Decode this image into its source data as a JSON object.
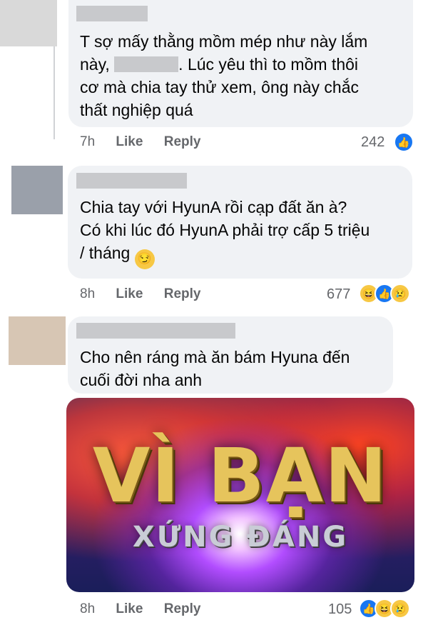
{
  "comments": [
    {
      "text_before": "T sợ mấy thằng mồm mép như này lắm\nnày,",
      "text_after": ". Lúc yêu thì to mồm thôi\ncơ mà chia tay thử xem, ông này chắc\nthất nghiệp quá",
      "time": "7h",
      "like_label": "Like",
      "reply_label": "Reply",
      "reaction_count": "242",
      "reactions": [
        "like"
      ]
    },
    {
      "text": "Chia tay với HyunA rồi cạp đất ăn à?\nCó khi lúc đó HyunA phải trợ cấp 5 triệu\n/ tháng",
      "emoji": "smirk",
      "time": "8h",
      "like_label": "Like",
      "reply_label": "Reply",
      "reaction_count": "677",
      "reactions": [
        "haha",
        "like",
        "sad"
      ]
    },
    {
      "text": "Cho nên ráng mà ăn bám Hyuna đến\ncuối đời nha anh",
      "meme": {
        "title": "VÌ BẠN",
        "subtitle": "XỨNG ĐÁNG"
      },
      "time": "8h",
      "like_label": "Like",
      "reply_label": "Reply",
      "reaction_count": "105",
      "reactions": [
        "like",
        "haha",
        "sad"
      ]
    }
  ],
  "colors": {
    "bubble": "#f0f2f5",
    "meta_text": "#65676b",
    "like_blue": "#1877f2",
    "reaction_yellow": "#f7c844"
  }
}
